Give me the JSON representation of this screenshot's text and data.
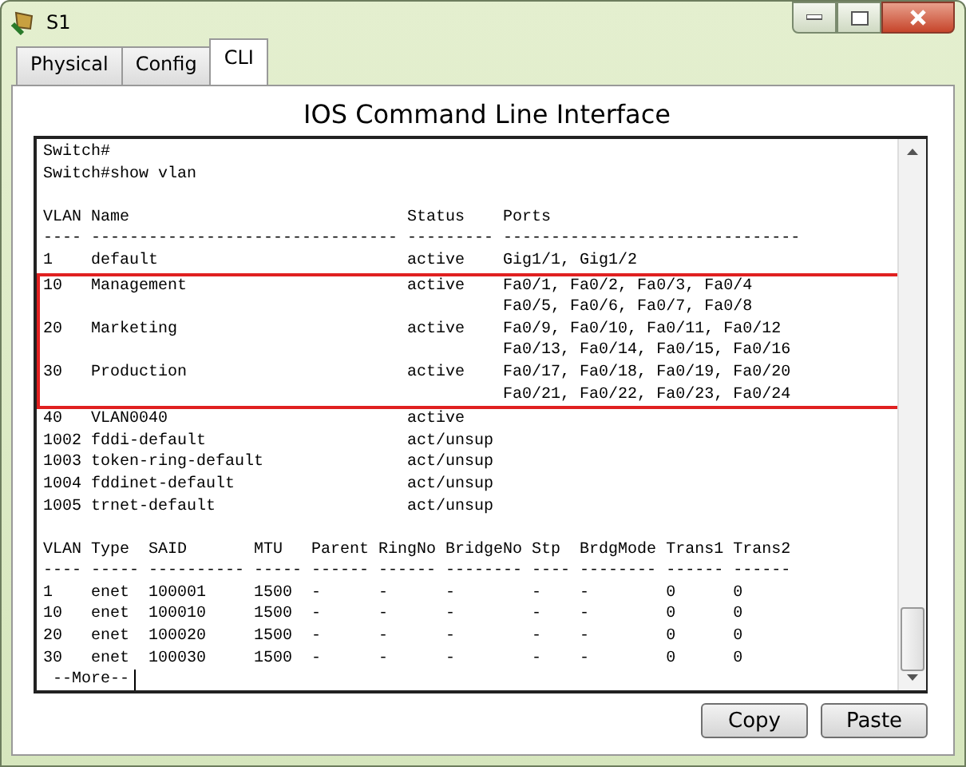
{
  "window": {
    "title": "S1"
  },
  "tabs": [
    {
      "label": "Physical",
      "selected": false
    },
    {
      "label": "Config",
      "selected": false
    },
    {
      "label": "CLI",
      "selected": true
    }
  ],
  "heading": "IOS Command Line Interface",
  "terminal": {
    "blocks": [
      {
        "highlighted": false,
        "lines": [
          {
            "kind": "text",
            "text": "Switch#"
          },
          {
            "kind": "text",
            "text": "Switch#show vlan"
          },
          {
            "kind": "blank"
          },
          {
            "kind": "text",
            "text": "VLAN Name                             Status    Ports"
          },
          {
            "kind": "text",
            "text": "---- -------------------------------- --------- -------------------------------"
          },
          {
            "kind": "text",
            "text": "1    default                          active    Gig1/1, Gig1/2"
          }
        ]
      },
      {
        "highlighted": true,
        "lines": [
          {
            "kind": "text",
            "text": "10   Management                       active    Fa0/1, Fa0/2, Fa0/3, Fa0/4"
          },
          {
            "kind": "text",
            "text": "                                                Fa0/5, Fa0/6, Fa0/7, Fa0/8"
          },
          {
            "kind": "text",
            "text": "20   Marketing                        active    Fa0/9, Fa0/10, Fa0/11, Fa0/12"
          },
          {
            "kind": "text",
            "text": "                                                Fa0/13, Fa0/14, Fa0/15, Fa0/16"
          },
          {
            "kind": "text",
            "text": "30   Production                       active    Fa0/17, Fa0/18, Fa0/19, Fa0/20"
          },
          {
            "kind": "text",
            "text": "                                                Fa0/21, Fa0/22, Fa0/23, Fa0/24"
          }
        ]
      },
      {
        "highlighted": false,
        "lines": [
          {
            "kind": "text",
            "text": "40   VLAN0040                         active"
          },
          {
            "kind": "text",
            "text": "1002 fddi-default                     act/unsup"
          },
          {
            "kind": "text",
            "text": "1003 token-ring-default               act/unsup"
          },
          {
            "kind": "text",
            "text": "1004 fddinet-default                  act/unsup"
          },
          {
            "kind": "text",
            "text": "1005 trnet-default                    act/unsup"
          },
          {
            "kind": "blank"
          },
          {
            "kind": "text",
            "text": "VLAN Type  SAID       MTU   Parent RingNo BridgeNo Stp  BrdgMode Trans1 Trans2"
          },
          {
            "kind": "text",
            "text": "---- ----- ---------- ----- ------ ------ -------- ---- -------- ------ ------"
          },
          {
            "kind": "text",
            "text": "1    enet  100001     1500  -      -      -        -    -        0      0"
          },
          {
            "kind": "text",
            "text": "10   enet  100010     1500  -      -      -        -    -        0      0"
          },
          {
            "kind": "text",
            "text": "20   enet  100020     1500  -      -      -        -    -        0      0"
          },
          {
            "kind": "text",
            "text": "30   enet  100030     1500  -      -      -        -    -        0      0"
          }
        ]
      }
    ],
    "prompt": " --More--"
  },
  "buttons": [
    "Copy",
    "Paste"
  ]
}
